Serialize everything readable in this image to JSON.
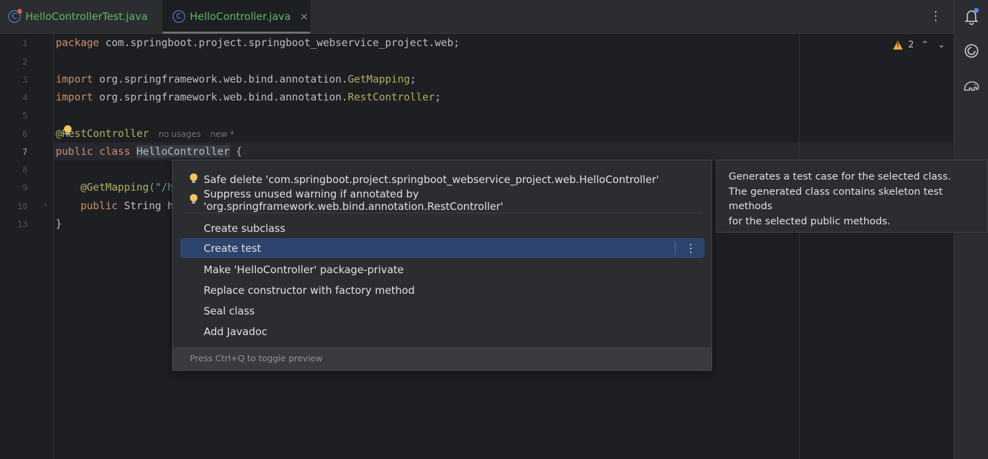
{
  "tabs": [
    {
      "label": "HelloControllerTest.java",
      "active": false,
      "icon": "class-c-error-icon"
    },
    {
      "label": "HelloController.java",
      "active": true,
      "icon": "class-c-icon",
      "close": "×"
    }
  ],
  "menu_glyph": "⋮",
  "gutter": {
    "lines": [
      "1",
      "2",
      "3",
      "4",
      "5",
      "6",
      "7",
      "8",
      "9",
      "10",
      "13"
    ],
    "current": "7"
  },
  "code": {
    "line1": {
      "kw": "package",
      "rest": " com.springboot.project.springboot_webservice_project.web;"
    },
    "line3": {
      "kw": "import",
      "mid": " org.springframework.web.bind.annotation.",
      "ann": "GetMapping",
      "end": ";"
    },
    "line4": {
      "kw": "import",
      "mid": " org.springframework.web.bind.annotation.",
      "ann": "RestController",
      "end": ";"
    },
    "line6": {
      "ann": "@RestController",
      "hint1": "no usages",
      "hint2": "new *"
    },
    "line7": {
      "kw": "public class",
      "cls": "HelloController",
      "end": " {"
    },
    "line9": {
      "ann": "@GetMapping",
      "str": "(\"/h"
    },
    "line10": {
      "kw": "public",
      "rest": " String h"
    },
    "line13": "}"
  },
  "inspection": {
    "warning_count": "2",
    "up": "⌃",
    "down": "⌄"
  },
  "popup": {
    "items": [
      {
        "label": "Safe delete 'com.springboot.project.springboot_webservice_project.web.HelloController'",
        "bulb": true
      },
      {
        "label": "Suppress unused warning if annotated by 'org.springframework.web.bind.annotation.RestController'",
        "bulb": true
      },
      {
        "label": "Create subclass"
      },
      {
        "label": "Create test",
        "selected": true
      },
      {
        "label": "Make 'HelloController' package-private"
      },
      {
        "label": "Replace constructor with factory method"
      },
      {
        "label": "Seal class"
      },
      {
        "label": "Add Javadoc"
      }
    ],
    "footer": "Press Ctrl+Q to toggle preview"
  },
  "preview": {
    "line1": "Generates a test case for the selected class.",
    "line2": "The generated class contains skeleton test methods",
    "line3": "for the selected public methods."
  },
  "tools": [
    "notifications-icon",
    "ai-assistant-icon",
    "database-icon"
  ],
  "colors": {
    "accent": "#548af7",
    "selection": "#2e436e",
    "bulb": "#f2c55c"
  }
}
